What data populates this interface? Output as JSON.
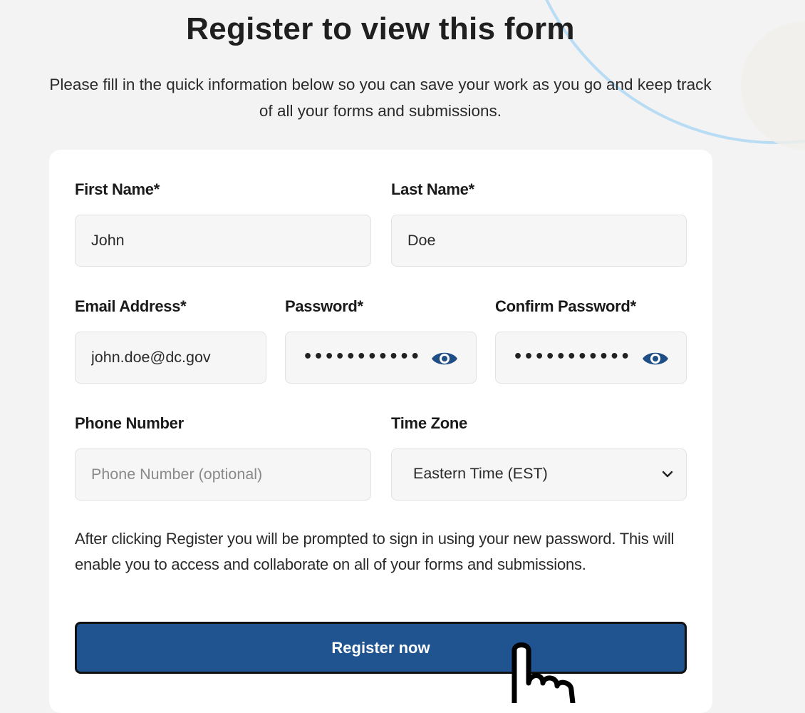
{
  "page": {
    "title": "Register to view this form",
    "subtitle": "Please fill in the quick information below so you can save your work as you go and keep track of all your forms and submissions."
  },
  "form": {
    "first_name": {
      "label": "First Name*",
      "value": "John"
    },
    "last_name": {
      "label": "Last Name*",
      "value": "Doe"
    },
    "email": {
      "label": "Email Address*",
      "value": "john.doe@dc.gov"
    },
    "password": {
      "label": "Password*",
      "masked_value": "•••••••••••",
      "toggle_icon": "eye-icon"
    },
    "confirm_password": {
      "label": "Confirm Password*",
      "masked_value": "•••••••••••",
      "toggle_icon": "eye-icon"
    },
    "phone": {
      "label": "Phone Number",
      "value": "",
      "placeholder": "Phone Number (optional)"
    },
    "time_zone": {
      "label": "Time Zone",
      "selected": "Eastern Time (EST)",
      "icon": "chevron-down-icon"
    },
    "note": "After clicking Register you will be prompted to sign in using your new password. This will enable you to access and collaborate on all of your forms and submissions.",
    "submit_label": "Register now"
  },
  "colors": {
    "background": "#f3f3f3",
    "card": "#ffffff",
    "field_bg": "#f6f6f6",
    "button": "#1f5490",
    "eye_icon": "#1f4e86",
    "deco_circle": "#b9dcf5"
  }
}
